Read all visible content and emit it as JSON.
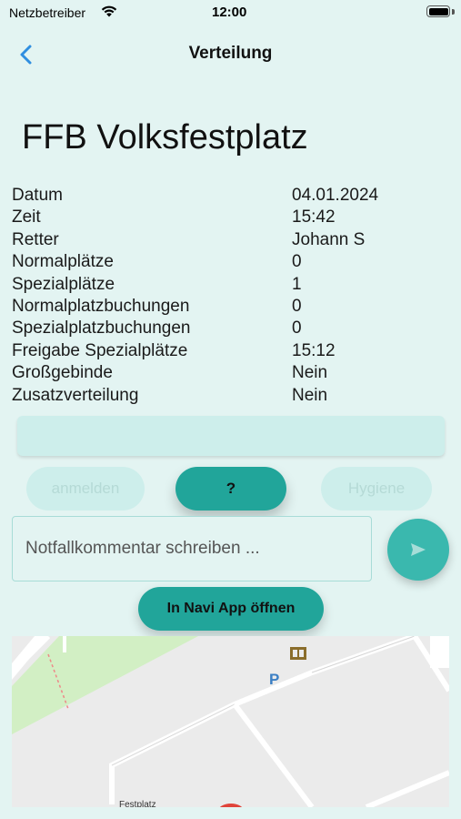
{
  "status_bar": {
    "carrier": "Netzbetreiber",
    "time": "12:00"
  },
  "nav": {
    "title": "Verteilung"
  },
  "page_title": "FFB Volksfestplatz",
  "details": [
    {
      "label": "Datum",
      "value": "04.01.2024"
    },
    {
      "label": "Zeit",
      "value": "15:42"
    },
    {
      "label": "Retter",
      "value": "Johann S"
    },
    {
      "label": "Normalplätze",
      "value": "0"
    },
    {
      "label": "Spezialplätze",
      "value": "1"
    },
    {
      "label": "Normalplatzbuchungen",
      "value": "0"
    },
    {
      "label": "Spezialplatzbuchungen",
      "value": "0"
    },
    {
      "label": "Freigabe Spezialplätze",
      "value": "15:12"
    },
    {
      "label": "Großgebinde",
      "value": "Nein"
    },
    {
      "label": "Zusatzverteilung",
      "value": "Nein"
    }
  ],
  "actions": {
    "register_label": "anmelden",
    "help_label": "?",
    "hygiene_label": "Hygiene"
  },
  "comment": {
    "placeholder": "Notfallkommentar schreiben ..."
  },
  "navi_button_label": "In Navi App öffnen",
  "map": {
    "label": "Festplatz",
    "parking_symbol": "P"
  },
  "colors": {
    "background": "#e3f4f2",
    "accent": "#21a59a",
    "back_arrow": "#2f8ee0"
  }
}
